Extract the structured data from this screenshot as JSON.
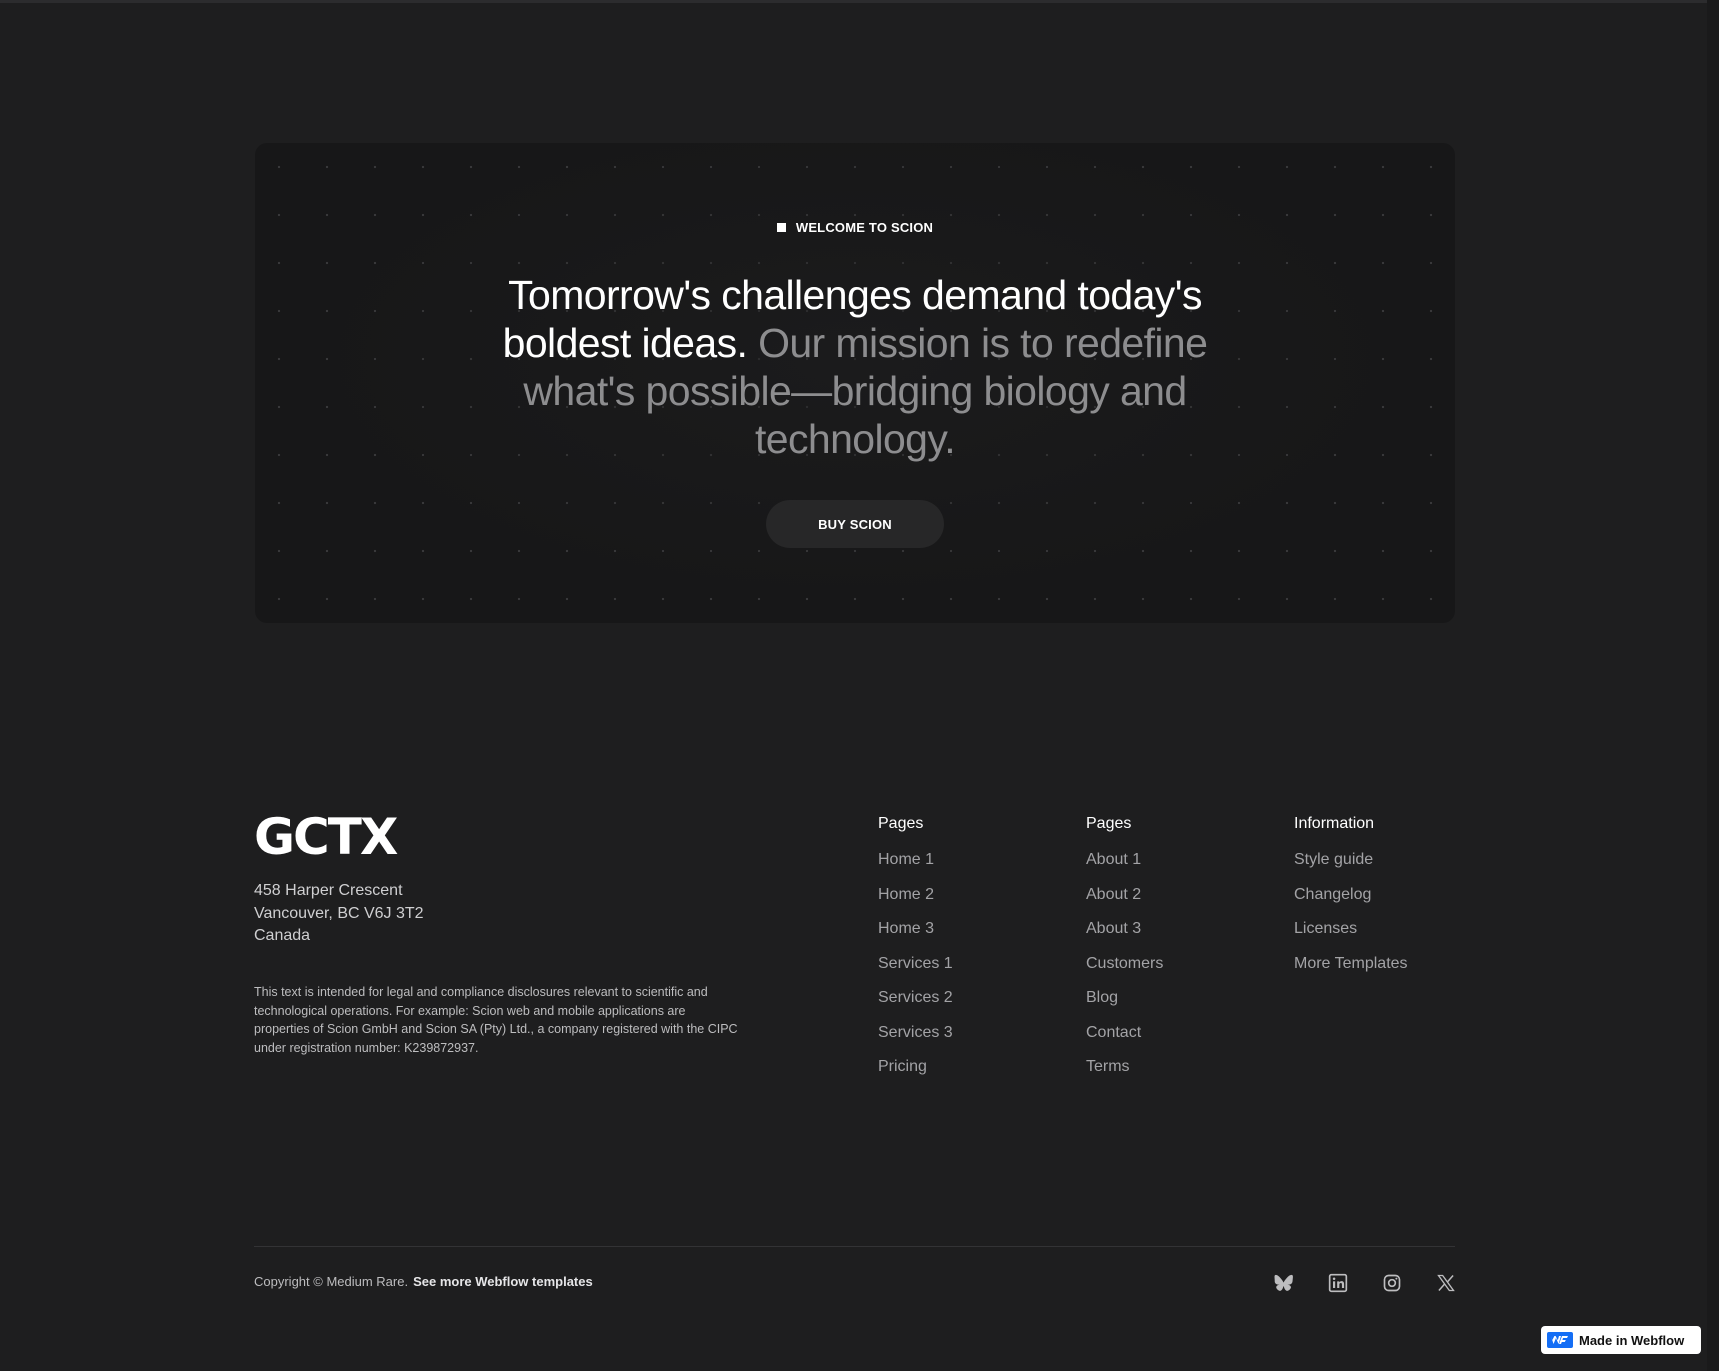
{
  "hero": {
    "eyebrow": "WELCOME TO SCION",
    "headline_strong": "Tomorrow's challenges demand today's boldest ideas.",
    "headline_muted": "Our mission is to redefine what's possible—bridging biology and technology.",
    "cta_label": "BUY SCION"
  },
  "footer": {
    "logo_text": "GCTX",
    "address": [
      "458 Harper Crescent",
      "Vancouver, BC V6J 3T2",
      "Canada"
    ],
    "legal": "This text is intended for legal and compliance disclosures relevant to scientific and technological operations. For example: Scion web and mobile applications are properties of Scion GmbH and Scion SA (Pty) Ltd., a company registered with the CIPC under registration number: K239872937.",
    "columns": [
      {
        "title": "Pages",
        "links": [
          "Home 1",
          "Home 2",
          "Home 3",
          "Services 1",
          "Services 2",
          "Services 3",
          "Pricing"
        ]
      },
      {
        "title": "Pages",
        "links": [
          "About 1",
          "About 2",
          "About 3",
          "Customers",
          "Blog",
          "Contact",
          "Terms"
        ]
      },
      {
        "title": "Information",
        "links": [
          "Style guide",
          "Changelog",
          "Licenses",
          "More Templates"
        ]
      }
    ],
    "copyright": "Copyright © Medium Rare.",
    "more_templates": "See more Webflow templates",
    "social_icons": [
      "bluesky-icon",
      "linkedin-icon",
      "instagram-icon",
      "x-icon"
    ]
  },
  "badge": {
    "label": "Made in Webflow",
    "icon": "webflow-icon"
  },
  "colors": {
    "background": "#1e1e1f",
    "hero_panel": "#171718",
    "muted_text": "#8d8d8f",
    "link_text": "#a3a3a6",
    "webflow_blue": "#146ef5"
  }
}
